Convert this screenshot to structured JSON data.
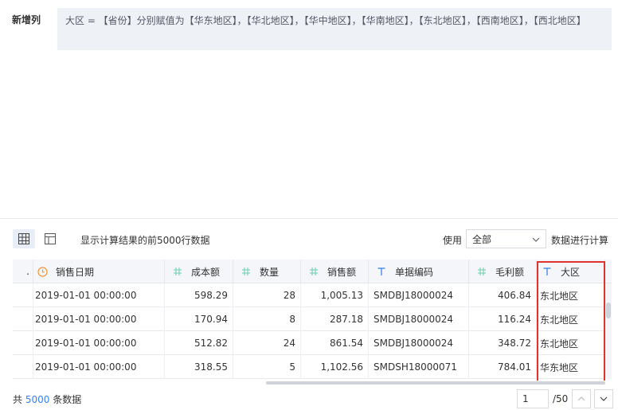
{
  "formula": {
    "label": "新增列",
    "text": "大区 = 【省份】分别赋值为【华东地区】，【华北地区】，【华中地区】，【华南地区】，【东北地区】，【西南地区】，【西北地区】"
  },
  "toolbar": {
    "info": "显示计算结果的前5000行数据",
    "use_label": "使用",
    "select_value": "全部",
    "after_select": "数据进行计算"
  },
  "table": {
    "columns": [
      {
        "label": ".",
        "icon": "none"
      },
      {
        "label": "销售日期",
        "icon": "clock-icon"
      },
      {
        "label": "成本额",
        "icon": "hash-icon"
      },
      {
        "label": "数量",
        "icon": "hash-icon"
      },
      {
        "label": "销售额",
        "icon": "hash-icon"
      },
      {
        "label": "单据编码",
        "icon": "text-t-icon"
      },
      {
        "label": "毛利额",
        "icon": "hash-icon"
      },
      {
        "label": "大区",
        "icon": "text-t-icon"
      }
    ],
    "rows": [
      [
        "",
        "2019-01-01 00:00:00",
        "598.29",
        "28",
        "1,005.13",
        "SMDBJ18000024",
        "406.84",
        "东北地区"
      ],
      [
        "",
        "2019-01-01 00:00:00",
        "170.94",
        "8",
        "287.18",
        "SMDBJ18000024",
        "116.24",
        "东北地区"
      ],
      [
        "",
        "2019-01-01 00:00:00",
        "512.82",
        "24",
        "861.54",
        "SMDBJ18000024",
        "348.72",
        "东北地区"
      ],
      [
        "",
        "2019-01-01 00:00:00",
        "318.55",
        "5",
        "1,102.56",
        "SMDSH18000071",
        "784.01",
        "华东地区"
      ]
    ]
  },
  "footer": {
    "prefix": "共",
    "count": "5000",
    "suffix": "条数据",
    "page_value": "1",
    "page_total": "/50"
  },
  "colors": {
    "accent": "#3685f2",
    "highlight_border": "#e0322f",
    "hash_icon": "#7ed3b6",
    "clock_icon": "#f0963a",
    "text_icon": "#3685f2"
  }
}
